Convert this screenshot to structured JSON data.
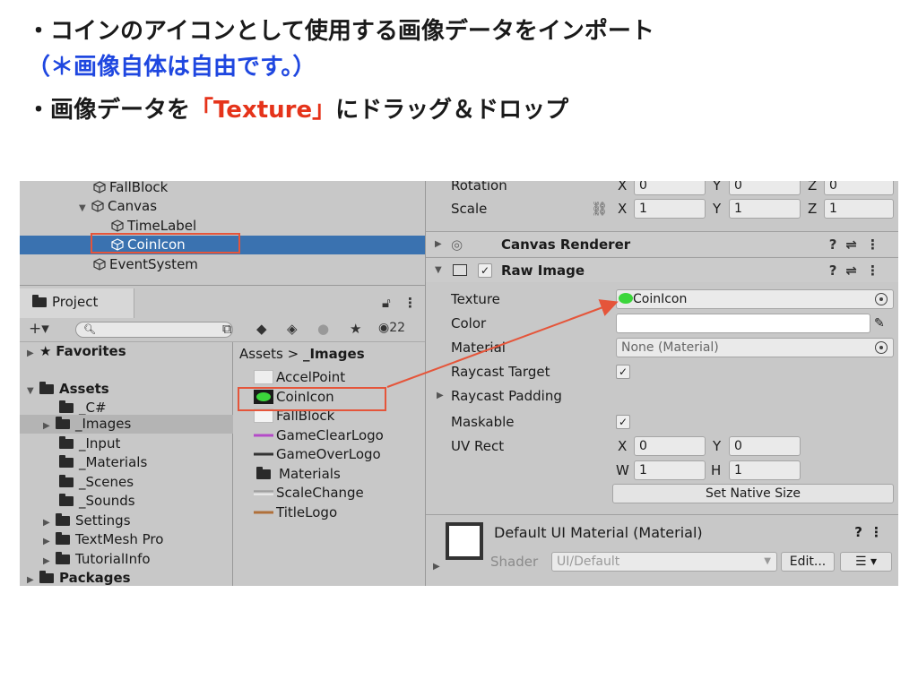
{
  "slide": {
    "line1": "・コインのアイコンとして使用する画像データをインポート",
    "line2": "（＊画像自体は自由です。）",
    "line3_pre": "・画像データを",
    "line3_red": "「Texture」",
    "line3_post": "にドラッグ＆ドロップ"
  },
  "hierarchy": {
    "items": [
      {
        "label": "FallBlock"
      },
      {
        "label": "Canvas"
      },
      {
        "label": "TimeLabel"
      },
      {
        "label": "CoinIcon"
      },
      {
        "label": "EventSystem"
      }
    ]
  },
  "project": {
    "tab_label": "Project",
    "add_label": "+▾",
    "hidden_count": "22",
    "tree": {
      "favorites": "Favorites",
      "assets": "Assets",
      "folders": [
        "_C#",
        "_Images",
        "_Input",
        "_Materials",
        "_Scenes",
        "_Sounds",
        "Settings",
        "TextMesh Pro",
        "TutorialInfo"
      ],
      "packages": "Packages"
    },
    "breadcrumb": {
      "root": "Assets",
      "separator": ">",
      "current": "_Images"
    },
    "assets": [
      {
        "label": "AccelPoint"
      },
      {
        "label": "CoinIcon"
      },
      {
        "label": "FallBlock"
      },
      {
        "label": "GameClearLogo"
      },
      {
        "label": "GameOverLogo"
      },
      {
        "label": "Materials"
      },
      {
        "label": "ScaleChange"
      },
      {
        "label": "TitleLogo"
      }
    ]
  },
  "inspector": {
    "rotation": {
      "label": "Rotation",
      "x": "0",
      "y": "0",
      "z": "0"
    },
    "scale": {
      "label": "Scale",
      "x": "1",
      "y": "1",
      "z": "1"
    },
    "axis_labels": {
      "x": "X",
      "y": "Y",
      "z": "Z",
      "w": "W",
      "h": "H"
    },
    "canvas_renderer": "Canvas Renderer",
    "raw_image": "Raw Image",
    "fields": {
      "texture_label": "Texture",
      "texture_value": "CoinIcon",
      "color_label": "Color",
      "material_label": "Material",
      "material_value": "None (Material)",
      "raycast_target_label": "Raycast Target",
      "raycast_padding_label": "Raycast Padding",
      "maskable_label": "Maskable",
      "uv_rect_label": "UV Rect",
      "uv_x": "0",
      "uv_y": "0",
      "uv_w": "1",
      "uv_h": "1"
    },
    "set_native_size": "Set Native Size",
    "default_material": {
      "title": "Default UI Material (Material)",
      "shader_label": "Shader",
      "shader_value": "UI/Default",
      "edit_label": "Edit..."
    }
  },
  "colors": {
    "accent_blue": "#1f47e0",
    "accent_red": "#e5331a",
    "selection": "#3a72b0",
    "highlight_box": "#e5553a"
  }
}
